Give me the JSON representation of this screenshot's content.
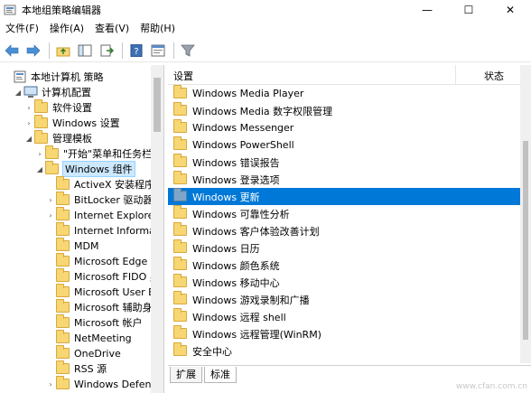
{
  "window": {
    "title": "本地组策略编辑器",
    "controls": [
      "—",
      "☐",
      "✕"
    ]
  },
  "menubar": [
    {
      "label": "文件(F)"
    },
    {
      "label": "操作(A)"
    },
    {
      "label": "查看(V)"
    },
    {
      "label": "帮助(H)"
    }
  ],
  "toolbar": [
    "back-arrow-icon",
    "forward-arrow-icon",
    "up-folder-icon",
    "show-hide-tree-icon",
    "export-list-icon",
    "help-icon",
    "properties-icon",
    "filter-icon"
  ],
  "tree": [
    {
      "label": "本地计算机 策略",
      "level": 0,
      "twisty": "",
      "icon": "computer-policy-icon"
    },
    {
      "label": "计算机配置",
      "level": 1,
      "twisty": "◢",
      "icon": "computer-icon"
    },
    {
      "label": "软件设置",
      "level": 2,
      "twisty": "›",
      "icon": "folder-icon"
    },
    {
      "label": "Windows 设置",
      "level": 2,
      "twisty": "›",
      "icon": "folder-icon"
    },
    {
      "label": "管理模板",
      "level": 2,
      "twisty": "◢",
      "icon": "folder-icon"
    },
    {
      "label": "\"开始\"菜单和任务栏",
      "level": 3,
      "twisty": "›",
      "icon": "folder-icon"
    },
    {
      "label": "Windows 组件",
      "level": 3,
      "twisty": "◢",
      "icon": "folder-icon",
      "selected": true
    },
    {
      "label": "ActiveX 安装程序",
      "level": 4,
      "twisty": "",
      "icon": "folder-icon"
    },
    {
      "label": "BitLocker 驱动器",
      "level": 4,
      "twisty": "›",
      "icon": "folder-icon"
    },
    {
      "label": "Internet Explorer",
      "level": 4,
      "twisty": "›",
      "icon": "folder-icon"
    },
    {
      "label": "Internet Informa",
      "level": 4,
      "twisty": "",
      "icon": "folder-icon"
    },
    {
      "label": "MDM",
      "level": 4,
      "twisty": "",
      "icon": "folder-icon"
    },
    {
      "label": "Microsoft Edge",
      "level": 4,
      "twisty": "",
      "icon": "folder-icon"
    },
    {
      "label": "Microsoft FIDO 身",
      "level": 4,
      "twisty": "",
      "icon": "folder-icon"
    },
    {
      "label": "Microsoft User E",
      "level": 4,
      "twisty": "",
      "icon": "folder-icon"
    },
    {
      "label": "Microsoft 辅助身",
      "level": 4,
      "twisty": "",
      "icon": "folder-icon"
    },
    {
      "label": "Microsoft 帐户",
      "level": 4,
      "twisty": "",
      "icon": "folder-icon"
    },
    {
      "label": "NetMeeting",
      "level": 4,
      "twisty": "",
      "icon": "folder-icon"
    },
    {
      "label": "OneDrive",
      "level": 4,
      "twisty": "",
      "icon": "folder-icon"
    },
    {
      "label": "RSS 源",
      "level": 4,
      "twisty": "",
      "icon": "folder-icon"
    },
    {
      "label": "Windows Defen",
      "level": 4,
      "twisty": "›",
      "icon": "folder-icon"
    }
  ],
  "list": {
    "columns": {
      "setting": "设置",
      "state": "状态"
    },
    "items": [
      {
        "label": "Windows Media Player"
      },
      {
        "label": "Windows Media 数字权限管理"
      },
      {
        "label": "Windows Messenger"
      },
      {
        "label": "Windows PowerShell"
      },
      {
        "label": "Windows 错误报告"
      },
      {
        "label": "Windows 登录选项"
      },
      {
        "label": "Windows 更新",
        "selected": true
      },
      {
        "label": "Windows 可靠性分析"
      },
      {
        "label": "Windows 客户体验改善计划"
      },
      {
        "label": "Windows 日历"
      },
      {
        "label": "Windows 颜色系统"
      },
      {
        "label": "Windows 移动中心"
      },
      {
        "label": "Windows 游戏录制和广播"
      },
      {
        "label": "Windows 远程 shell"
      },
      {
        "label": "Windows 远程管理(WinRM)"
      },
      {
        "label": "安全中心"
      }
    ]
  },
  "tabs": [
    {
      "label": "扩展"
    },
    {
      "label": "标准",
      "active": true
    }
  ],
  "watermark": "www.cfan.com.cn"
}
